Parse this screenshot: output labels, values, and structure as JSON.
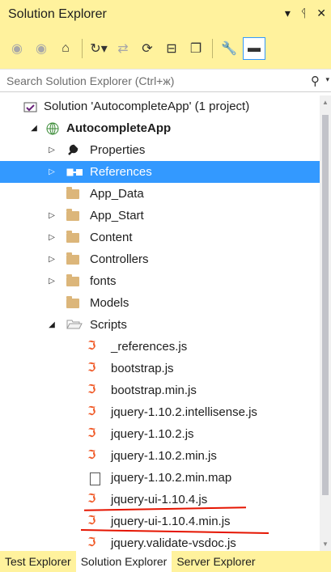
{
  "window": {
    "title": "Solution Explorer",
    "controls": {
      "dropdown": "▾",
      "pin": "ᛩ",
      "close": "✕"
    }
  },
  "toolbar": {
    "buttons": [
      "back",
      "forward",
      "home",
      "pending-changes",
      "sync",
      "refresh",
      "collapse-all",
      "show-all-files",
      "properties",
      "preview"
    ]
  },
  "search": {
    "placeholder": "Search Solution Explorer (Ctrl+ж)"
  },
  "tree": [
    {
      "label": "Solution 'AutocompleteApp' (1 project)",
      "icon": "solution-icon",
      "arrow": ""
    },
    {
      "label": "AutocompleteApp",
      "icon": "web-project-icon",
      "arrow": "expanded",
      "bold": true
    },
    {
      "label": "Properties",
      "icon": "wrench-icon",
      "arrow": "collapsed"
    },
    {
      "label": "References",
      "icon": "references-icon",
      "arrow": "collapsed",
      "selected": true
    },
    {
      "label": "App_Data",
      "icon": "folder-icon",
      "arrow": ""
    },
    {
      "label": "App_Start",
      "icon": "folder-icon",
      "arrow": "collapsed"
    },
    {
      "label": "Content",
      "icon": "folder-icon",
      "arrow": "collapsed"
    },
    {
      "label": "Controllers",
      "icon": "folder-icon",
      "arrow": "collapsed"
    },
    {
      "label": "fonts",
      "icon": "folder-icon",
      "arrow": "collapsed"
    },
    {
      "label": "Models",
      "icon": "folder-icon",
      "arrow": ""
    },
    {
      "label": "Scripts",
      "icon": "open-folder-icon",
      "arrow": "expanded"
    },
    {
      "label": "_references.js",
      "icon": "js-file-icon",
      "arrow": ""
    },
    {
      "label": "bootstrap.js",
      "icon": "js-file-icon",
      "arrow": ""
    },
    {
      "label": "bootstrap.min.js",
      "icon": "js-file-icon",
      "arrow": ""
    },
    {
      "label": "jquery-1.10.2.intellisense.js",
      "icon": "js-file-icon",
      "arrow": ""
    },
    {
      "label": "jquery-1.10.2.js",
      "icon": "js-file-icon",
      "arrow": ""
    },
    {
      "label": "jquery-1.10.2.min.js",
      "icon": "js-file-icon",
      "arrow": ""
    },
    {
      "label": "jquery-1.10.2.min.map",
      "icon": "map-file-icon",
      "arrow": ""
    },
    {
      "label": "jquery-ui-1.10.4.js",
      "icon": "js-file-icon",
      "arrow": "",
      "underlined": true
    },
    {
      "label": "jquery-ui-1.10.4.min.js",
      "icon": "js-file-icon",
      "arrow": "",
      "underlined": true
    },
    {
      "label": "jquery.validate-vsdoc.js",
      "icon": "js-file-icon",
      "arrow": ""
    }
  ],
  "tabs": [
    {
      "label": "Test Explorer",
      "active": false
    },
    {
      "label": "Solution Explorer",
      "active": true
    },
    {
      "label": "Server Explorer",
      "active": false
    }
  ],
  "colors": {
    "accent_yellow": "#FFF29D",
    "selection": "#3399FF",
    "folder": "#DCB67A",
    "js_icon": "#F05A28",
    "annotation_underline": "#E51400"
  }
}
